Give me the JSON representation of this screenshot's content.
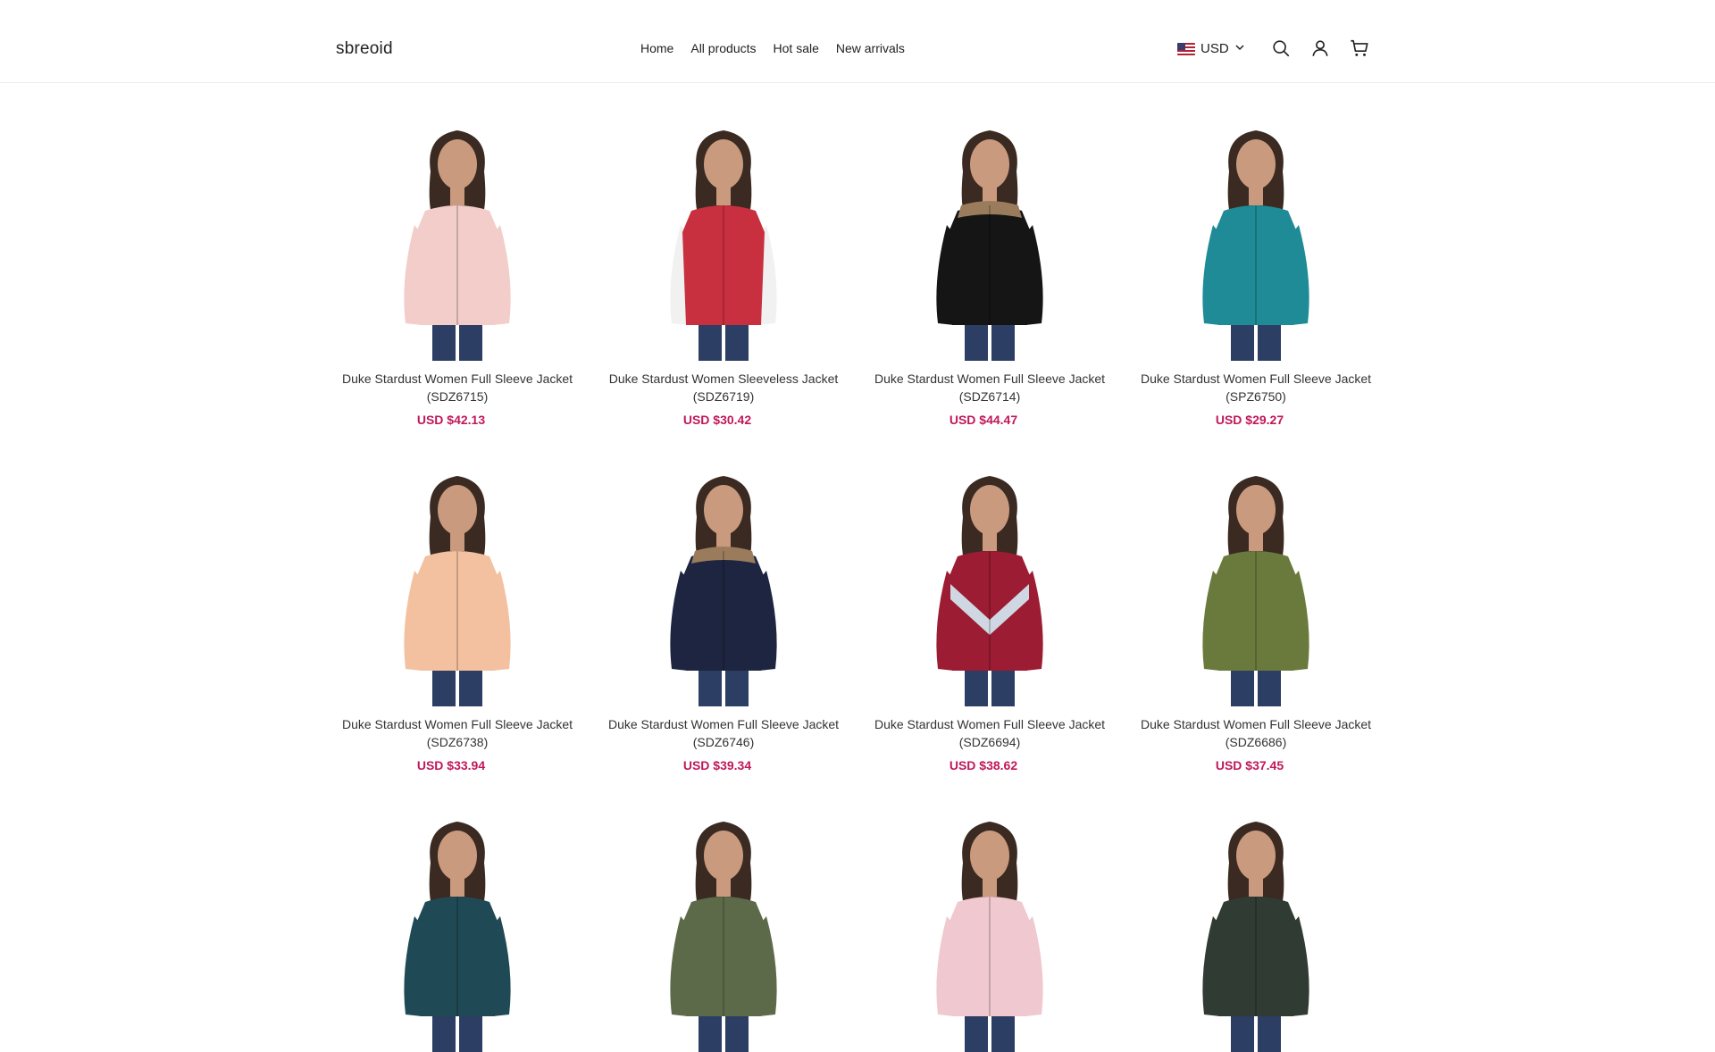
{
  "header": {
    "logo": "sbreoid",
    "nav": [
      "Home",
      "All products",
      "Hot sale",
      "New arrivals"
    ],
    "currency": "USD",
    "icons": [
      "search-icon",
      "account-icon",
      "cart-icon"
    ]
  },
  "colors": {
    "price": "#c0185a",
    "text": "#222222",
    "divider": "#ececec"
  },
  "products": [
    {
      "title": "Duke Stardust Women Full Sleeve Jacket (SDZ6715)",
      "price": "USD $42.13",
      "jacket_color": "#f2cdc9",
      "style": "jacket"
    },
    {
      "title": "Duke Stardust Women Sleeveless Jacket (SDZ6719)",
      "price": "USD $30.42",
      "jacket_color": "#c9303f",
      "style": "vest"
    },
    {
      "title": "Duke Stardust Women Full Sleeve Jacket (SDZ6714)",
      "price": "USD $44.47",
      "jacket_color": "#151515",
      "style": "hooded"
    },
    {
      "title": "Duke Stardust Women Full Sleeve Jacket (SPZ6750)",
      "price": "USD $29.27",
      "jacket_color": "#1e8b96",
      "style": "jacket"
    },
    {
      "title": "Duke Stardust Women Full Sleeve Jacket (SDZ6738)",
      "price": "USD $33.94",
      "jacket_color": "#f3c1a0",
      "style": "jacket"
    },
    {
      "title": "Duke Stardust Women Full Sleeve Jacket (SDZ6746)",
      "price": "USD $39.34",
      "jacket_color": "#1e2540",
      "style": "hooded"
    },
    {
      "title": "Duke Stardust Women Full Sleeve Jacket (SDZ6694)",
      "price": "USD $38.62",
      "jacket_color": "#9c1c33",
      "style": "stripe"
    },
    {
      "title": "Duke Stardust Women Full Sleeve Jacket (SDZ6686)",
      "price": "USD $37.45",
      "jacket_color": "#6a7a3c",
      "style": "jacket"
    },
    {
      "title": "",
      "price": "",
      "jacket_color": "#1f4a55",
      "style": "jacket"
    },
    {
      "title": "",
      "price": "",
      "jacket_color": "#5d6a4a",
      "style": "jacket"
    },
    {
      "title": "",
      "price": "",
      "jacket_color": "#f0c8cf",
      "style": "jacket"
    },
    {
      "title": "",
      "price": "",
      "jacket_color": "#2f3b33",
      "style": "jacket"
    }
  ]
}
